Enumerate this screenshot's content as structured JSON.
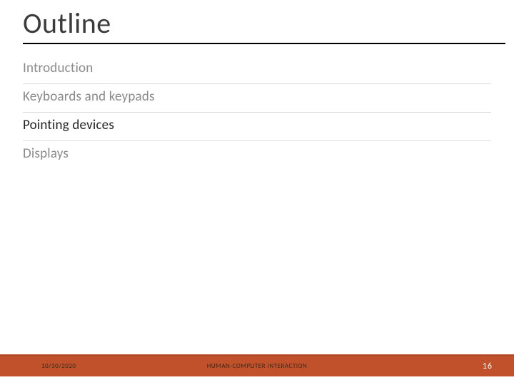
{
  "title": "Outline",
  "items": [
    {
      "label": "Introduction",
      "current": false
    },
    {
      "label": "Keyboards and keypads",
      "current": false
    },
    {
      "label": "Pointing devices",
      "current": true
    },
    {
      "label": "Displays",
      "current": false
    }
  ],
  "footer": {
    "date": "10/30/2020",
    "title": "HUMAN-COMPUTER INTERACTION",
    "page": "16"
  }
}
